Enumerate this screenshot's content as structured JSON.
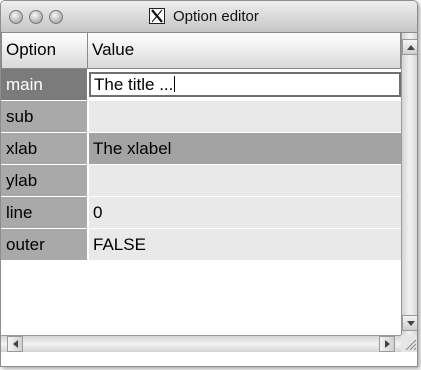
{
  "window": {
    "title": "Option editor",
    "title_icon": "x11-icon"
  },
  "table": {
    "columns": [
      "Option",
      "Value"
    ],
    "rows": [
      {
        "option": "main",
        "value": "The title ...",
        "state": "editing"
      },
      {
        "option": "sub",
        "value": ""
      },
      {
        "option": "xlab",
        "value": "The xlabel",
        "state": "highlighted"
      },
      {
        "option": "ylab",
        "value": ""
      },
      {
        "option": "line",
        "value": "0"
      },
      {
        "option": "outer",
        "value": "FALSE"
      }
    ]
  },
  "colors": {
    "selected_key": "#7b7b7b",
    "key_bg": "#a9a9a9",
    "value_bg": "#e9e9e9",
    "highlight_value": "#a3a3a3"
  }
}
